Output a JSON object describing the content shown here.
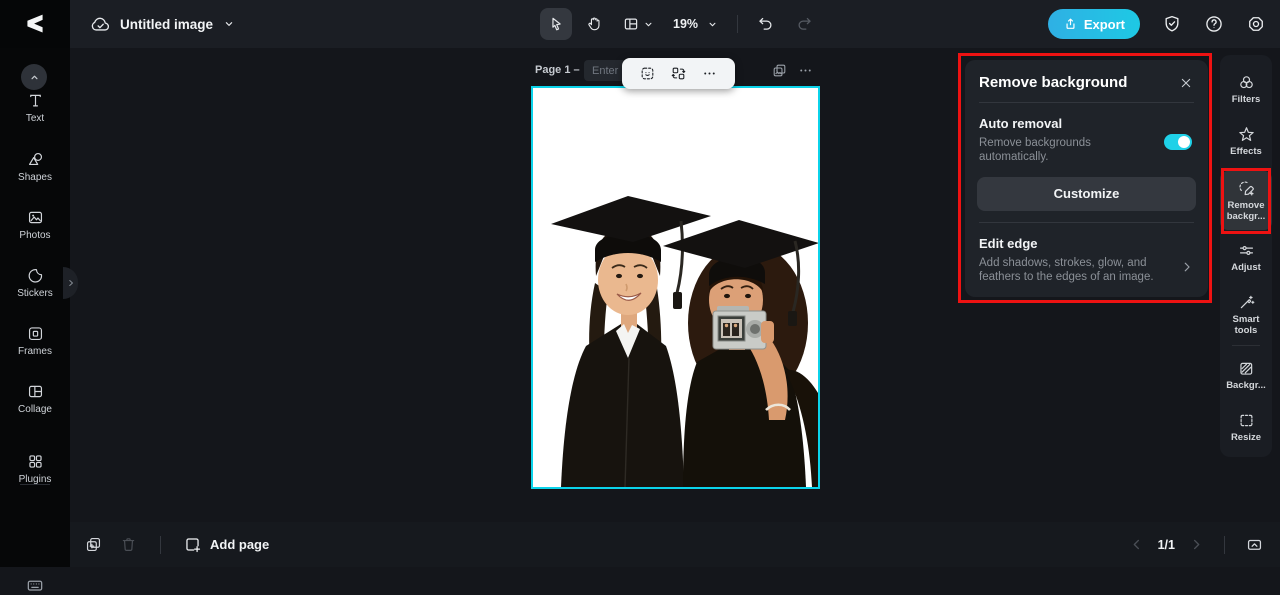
{
  "topbar": {
    "document_title": "Untitled image",
    "zoom_level": "19%",
    "export_label": "Export"
  },
  "left_sidebar": {
    "items": [
      {
        "id": "text",
        "label": "Text"
      },
      {
        "id": "shapes",
        "label": "Shapes"
      },
      {
        "id": "photos",
        "label": "Photos"
      },
      {
        "id": "stickers",
        "label": "Stickers"
      },
      {
        "id": "frames",
        "label": "Frames"
      },
      {
        "id": "collage",
        "label": "Collage"
      },
      {
        "id": "plugins",
        "label": "Plugins"
      }
    ]
  },
  "canvas_area": {
    "page_label": "Page 1 –",
    "page_title_placeholder": "Enter"
  },
  "remove_bg_panel": {
    "title": "Remove background",
    "auto_removal_title": "Auto removal",
    "auto_removal_description": "Remove backgrounds automatically.",
    "auto_removal_enabled": true,
    "customize_label": "Customize",
    "edit_edge_title": "Edit edge",
    "edit_edge_description": "Add shadows, strokes, glow, and feathers to the edges of an image."
  },
  "right_sidebar": {
    "items": [
      {
        "id": "filters",
        "label": "Filters",
        "selected": false
      },
      {
        "id": "effects",
        "label": "Effects",
        "selected": false
      },
      {
        "id": "remove-background",
        "label": "Remove backgr...",
        "selected": true
      },
      {
        "id": "adjust",
        "label": "Adjust",
        "selected": false
      },
      {
        "id": "smart-tools",
        "label": "Smart tools",
        "selected": false
      },
      {
        "id": "background",
        "label": "Backgr...",
        "selected": false
      },
      {
        "id": "resize",
        "label": "Resize",
        "selected": false
      }
    ]
  },
  "bottombar": {
    "add_page_label": "Add page",
    "page_indicator": "1/1"
  },
  "colors": {
    "accent_cyan": "#1ec9e4",
    "toggle_on": "#1fd1e8",
    "canvas_border": "#0bd3ea",
    "annotation_red": "#ee1212"
  }
}
